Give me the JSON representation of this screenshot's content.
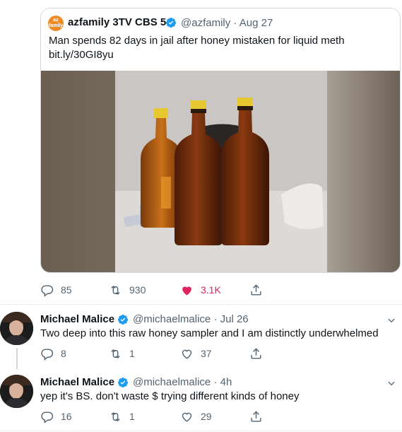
{
  "quoted_tweet": {
    "avatar_text": "az family",
    "name": "azfamily 3TV CBS 5",
    "handle": "@azfamily",
    "separator": "·",
    "date": "Aug 27",
    "text_line1": "Man spends 82 days in jail after honey mistaken for liquid meth",
    "text_line2": "bit.ly/30GI8yu",
    "image_alt": "three bottles of honey",
    "brand_color": "#f08a24"
  },
  "quoted_actions": {
    "replies": "85",
    "retweets": "930",
    "likes": "3.1K",
    "like_color": "#e0245e"
  },
  "tweets": [
    {
      "name": "Michael Malice",
      "handle": "@michaelmalice",
      "separator": "·",
      "date": "Jul 26",
      "text": "Two deep into this raw honey sampler and I am distinctly underwhelmed",
      "replies": "8",
      "retweets": "1",
      "likes": "37"
    },
    {
      "name": "Michael Malice",
      "handle": "@michaelmalice",
      "separator": "·",
      "date": "4h",
      "text": "yep it's BS. don't waste $ trying different kinds of honey",
      "replies": "16",
      "retweets": "1",
      "likes": "29"
    }
  ],
  "icons": [
    "reply-icon",
    "retweet-icon",
    "like-icon",
    "share-icon",
    "verified-icon",
    "chevron-down-icon"
  ],
  "colors": {
    "verified": "#1d9bf0",
    "muted": "#536471",
    "border": "#cfd9de"
  }
}
